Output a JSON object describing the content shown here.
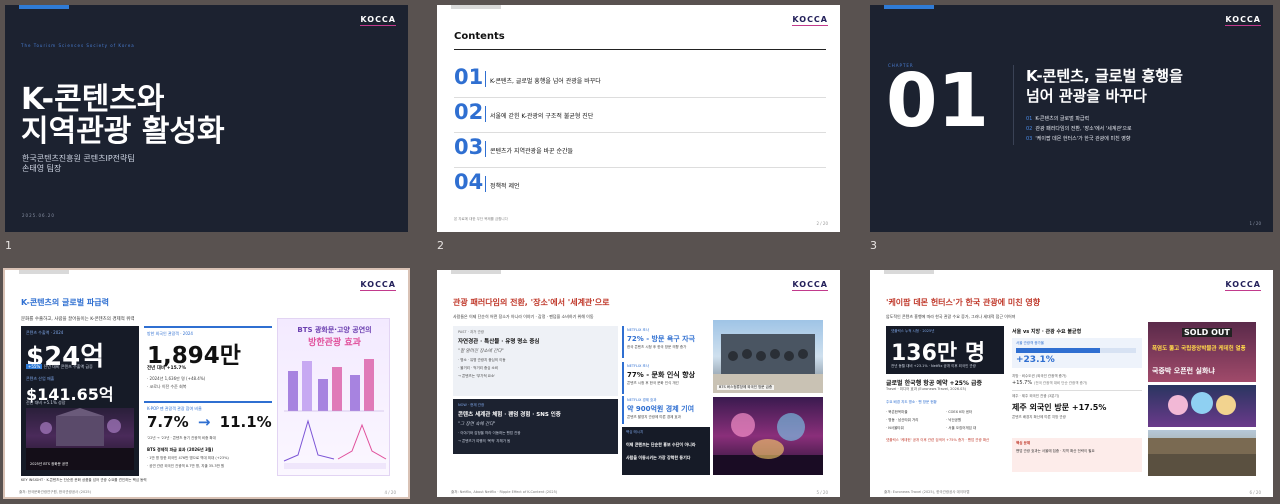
{
  "slide1": {
    "number": "1",
    "logo": "KOCCA",
    "society": "The Tourism Sciences Society of Korea",
    "title_line1": "K-콘텐츠와",
    "title_line2": "지역관광 활성화",
    "subtitle_line1": "한국콘텐츠진흥원 콘텐츠IP전략팀",
    "subtitle_line2": "손태영 팀장",
    "date": "2025.06.20"
  },
  "slide2": {
    "number": "2",
    "logo": "KOCCA",
    "heading": "Contents",
    "items": [
      {
        "num": "01",
        "label": "K-콘텐츠, 글로벌 흥행을 넘어 관광을 바꾸다"
      },
      {
        "num": "02",
        "label": "서울에 갇힌 K-관광의 구조적 불균형 진단"
      },
      {
        "num": "03",
        "label": "콘텐츠가 지역관광을 바꾼 순간들"
      },
      {
        "num": "04",
        "label": "정책적 제언"
      }
    ],
    "footnote": "본 자료에 대한 무단 복제를 금합니다",
    "page": "2 / 20"
  },
  "slide3": {
    "number": "3",
    "logo": "KOCCA",
    "chapter": "CHAPTER",
    "big_num": "01",
    "title_line1": "K-콘텐츠, 글로벌 흥행을",
    "title_line2": "넘어 관광을 바꾸다",
    "items": [
      {
        "n": "01",
        "t": "K-콘텐츠의 글로벌 파급력"
      },
      {
        "n": "02",
        "t": "관광 패러다임의 전환, '장소'에서 '세계관'으로"
      },
      {
        "n": "03",
        "t": "'케이팝 데몬 헌터스'가 한국 관광에 미친 영향"
      }
    ],
    "page": "1 / 20"
  },
  "slide4": {
    "number": "4",
    "logo": "KOCCA",
    "title": "K-콘텐츠의 글로벌 파급력",
    "lead": "문화를 수출하고, 사람을 끌어들이는 K-콘텐츠의 경제적 위력",
    "c1_label": "콘텐츠 수출액 · 2024",
    "c1_value": "$24억",
    "c1_badge": "+55%",
    "c1_badge_note": "전년 대비 콘텐츠 수출액 급증",
    "c1_label2": "콘텐츠 산업 매출",
    "c1_value2": "$141.65억",
    "c1_note2": "전년 대비 +5.1% 성장",
    "c1_photo_caption": "2025년 BTS 광화문 공연",
    "c2_label": "방한 외국인 관광객 · 2024",
    "c2_value": "1,894만",
    "c2_line1": "전년 대비 +15.7%",
    "c2_line2": "· 2024년 1,636만 명 (+48.4%)",
    "c2_line3": "· 코로나 이전 수준 회복",
    "c3_label": "K-POP 팬 관광객 관광 참여 비율",
    "c3_from": "7.7%",
    "c3_arrow": "→",
    "c3_to": "11.1%",
    "c3_note": "'22년 → '23년 · 콘텐츠 동기 관광객 비중 확대",
    "c3_head": "BTS 경제적 파급 효과 (2026년 3월)",
    "c3_l1": "· 1만 명 방한 외국인 476만 명으로 역대 최대 (+23%)",
    "c3_l2": "· 공연 관련 외국인 관광객 8.7만 명, 지출 35.3만 원",
    "poster_title1": "BTS 광화문·고양 공연의",
    "poster_title2": "방한관광 효과",
    "insight": "KEY INSIGHT · K-콘텐츠는 단순한 문화 상품을 넘어 관광 수요를 견인하는 핵심 동력",
    "footer": "출처: 한국문화관광연구원, 한국관광공사 (2025)",
    "page": "4 / 20"
  },
  "slide5": {
    "number": "5",
    "logo": "KOCCA",
    "title": "관광 패러다임의 전환, '장소'에서 '세계관'으로",
    "lead": "사람들은 이제 단순히 어떤 장소가 아니라 이야기 · 감정 · 팬덤을 소비하기 위해 이동",
    "past_label": "PAST · 과거 관광",
    "past_head": "자연경관 · 특산물 · 유명 명소 중심",
    "past_quote": "\"잘 알려진 장소에 간다\"",
    "past_l1": "· 명소 · 유명 관광지 중심의 이동",
    "past_l2": "· 볼거리 · 먹거리 중심 소비",
    "past_l3": "→ 콘텐츠는 '부가적 요소'",
    "now_label": "NOW · 현재 관광",
    "now_head": "콘텐츠 세계관 체험 · 팬덤 경험 · SNS 인증",
    "now_quote": "\"그 장면 속에 간다\"",
    "now_l1": "· 이야기와 감정을 따라 이동하는 팬덤 관광",
    "now_l2": "→ 콘텐츠가 여행의 '목적' 자체가 됨",
    "s1_label": "NETFLIX 조사",
    "s1_value": "72% - 방문 욕구 자극",
    "s1_note": "한국 콘텐츠 시청 후 한국 방문 의향 증가",
    "s2_label": "NETFLIX 조사",
    "s2_value": "77% - 문화 인식 향상",
    "s2_note": "콘텐츠 시청 후 한국 문화 인식 개선",
    "s3_label": "NETFLIX 경제 효과",
    "s3_value": "약 900억원 경제 기여",
    "s3_note": "콘텐츠 촬영지 관광에 따른 경제 효과",
    "bottom_label": "핵심 메시지",
    "bottom_l1": "이제 콘텐츠는 단순한 홍보 수단이 아니라",
    "bottom_l2": "사람을 이동시키는 가장 강력한 동기다",
    "photo1_caption": "BTS 버스정류장에 외국인 방문 급증",
    "footer": "출처: Netflix, About Netflix · Ripple Effect of K-Content (2025)",
    "page": "5 / 20"
  },
  "slide6": {
    "number": "6",
    "logo": "KOCCA",
    "title": "'케이팝 데몬 헌터스'가 한국 관광에 미친 영향",
    "lead": "압도적인 콘텐츠 흥행에 따라 한국 관광 수요 증가, 그러나 세대적 접근 이어져",
    "c1_label": "넷플릭스 누적 시청 · 2025년",
    "c1_value": "136만 명",
    "c1_note": "전년 동월 대비 +23.1% · Netflix 공개 이후 외국인 관광",
    "c1_head": "글로벌 한국행 항공 예약 +25% 급증",
    "c1_sub": "Travel · 미디어 효과 (Euronews Travel, 2026.03)",
    "c1_list_head": "주요 배경 지도 명소 · 팬 방문 현황",
    "c1_l1a": "· 북촌한옥마을",
    "c1_l1b": "· COEX K타 센터",
    "c1_l2a": "· 명동 · 남산타워 거리",
    "c1_l2b": "· 낙산공원",
    "c1_l3a": "· N서울타워",
    "c1_l3b": "· 서울 오징어게임 대",
    "c1_bottom": "넷플릭스 '케데헌' 공개 이후 관련 검색어 +75% 증가 · 팬덤 관광 확산",
    "chart_title": "서울 vs 지방 · 관광 수요 불균형",
    "bar_label": "서울 관광객 증가율",
    "bar_value": "+23.1%",
    "bar_pct": 70,
    "mid_label": "지방 · 비수도권 (외국인 관광객 증가)",
    "mid_value": "+15.7%",
    "mid_note": "(전국 관광객 대비 단순 관광객 증가)",
    "jeju_label": "제주 · 제주 외국인 관광 (3분기)",
    "jeju_value": "제주 외국인 방문 +17.5%",
    "jeju_note": "콘텐츠 배경지 확산에 따른 지방 관광",
    "warn_label": "핵심 문제",
    "warn_text": "팬덤 관광 효과는 서울에 집중 · 지역 확산 전략이 필요",
    "photo_sold": "SOLD OUT",
    "photo_line1": "폭염도 뚫고 국립중앙박물관 케데헌 열풍",
    "photo_line2": "국중박 오픈런 실화냐",
    "footer": "출처: Euronews Travel (2025), 한국관광공사 데이터랩",
    "page": "6 / 20"
  }
}
